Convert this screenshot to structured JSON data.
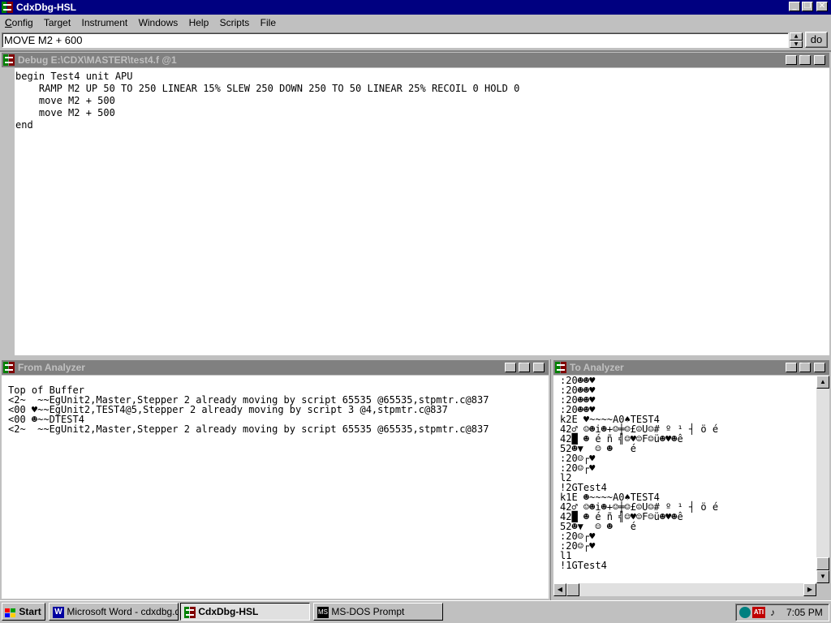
{
  "app": {
    "title": "CdxDbg-HSL",
    "menu": [
      "Config",
      "Target",
      "Instrument",
      "Windows",
      "Help",
      "Scripts",
      "File"
    ],
    "command_value": "MOVE M2 + 600",
    "do_label": "do"
  },
  "debug_window": {
    "title": "Debug E:\\CDX\\MASTER\\test4.f @1",
    "lines": [
      "begin Test4 unit APU",
      "    RAMP M2 UP 50 TO 250 LINEAR 15% SLEW 250 DOWN 250 TO 50 LINEAR 25% RECOIL 0 HOLD 0",
      "    move M2 + 500",
      "    move M2 + 500",
      "end"
    ]
  },
  "from_analyzer": {
    "title": "From Analyzer",
    "lines": [
      "Top of Buffer",
      "<2~  ~~EgUnit2,Master,Stepper 2 already moving by script 65535 @65535,stpmtr.c@837",
      "<00 ♥~~EgUnit2,TEST4@5,Stepper 2 already moving by script 3 @4,stpmtr.c@837",
      "<00 ☻~~DTEST4",
      "<2~  ~~EgUnit2,Master,Stepper 2 already moving by script 65535 @65535,stpmtr.c@837"
    ]
  },
  "to_analyzer": {
    "title": "To Analyzer",
    "lines": [
      ":20☻☻♥",
      ":20☻☻♥",
      ":20☻☻♥",
      ":20☻☻♥",
      "k2E ♥~~~~A0♠TEST4",
      "42♂ ☺☻i☻+☺╪☺£☺U☺# º ¹ ┤ ö é",
      "42█ ☻ é ñ ╣☺♥☺F☺ü☻♥☻ê",
      "52☻▼  ☺ ☻   é",
      ":20☺┌♥",
      ":20☺┌♥",
      "l2",
      "!2GTest4",
      "k1E ☻~~~~A0♠TEST4",
      "42♂ ☺☻i☻+☺╪☺£☺U☺# º ¹ ┤ ö é",
      "42█ ☻ é ñ ╣☺♥☺F☺ü☻♥☻ê",
      "52☻▼  ☺ ☻   é",
      ":20☺┌♥",
      ":20☺┌♥",
      "l1",
      "!1GTest4"
    ]
  },
  "taskbar": {
    "start_label": "Start",
    "tasks": [
      "Microsoft Word - cdxdbg.d...",
      "CdxDbg-HSL",
      "MS-DOS Prompt"
    ],
    "clock": "7:05 PM"
  },
  "colors": {
    "titlebar_active": "#000080",
    "titlebar_inactive": "#808080",
    "face": "#c0c0c0"
  }
}
